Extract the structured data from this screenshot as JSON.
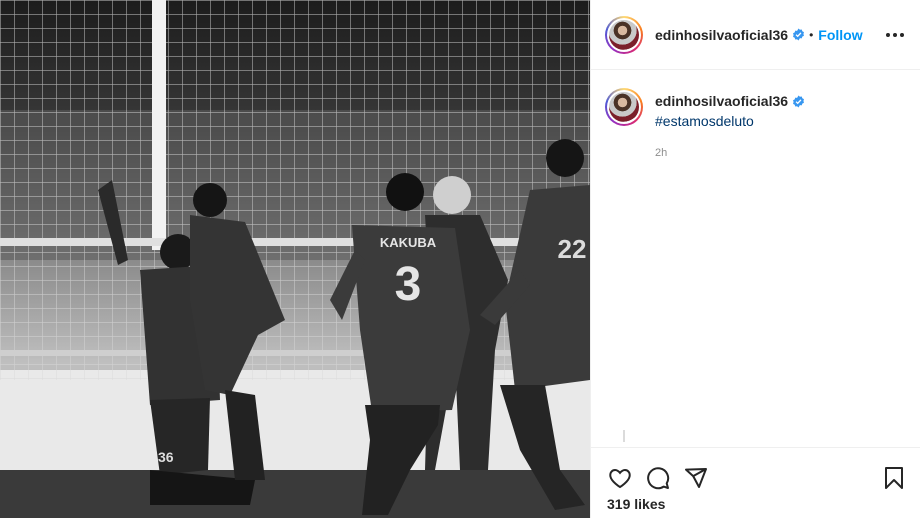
{
  "post": {
    "username": "edinhosilvaoficial36",
    "follow_label": "Follow",
    "separator": "•",
    "caption_username": "edinhosilvaoficial36",
    "hashtag": "#estamosdeluto",
    "time": "2h",
    "likes": "319 likes"
  },
  "photo": {
    "jersey_name": "KAKUBA",
    "jersey_number": "3",
    "shorts_number": "36",
    "back_player_number": "22"
  },
  "icons": {
    "verified": "verified-badge-icon",
    "more": "more-options-icon",
    "like": "heart-icon",
    "comment": "comment-icon",
    "share": "share-icon",
    "save": "bookmark-icon"
  },
  "colors": {
    "accent": "#0095f6",
    "hashtag": "#00376b",
    "muted": "#8e8e8e"
  }
}
